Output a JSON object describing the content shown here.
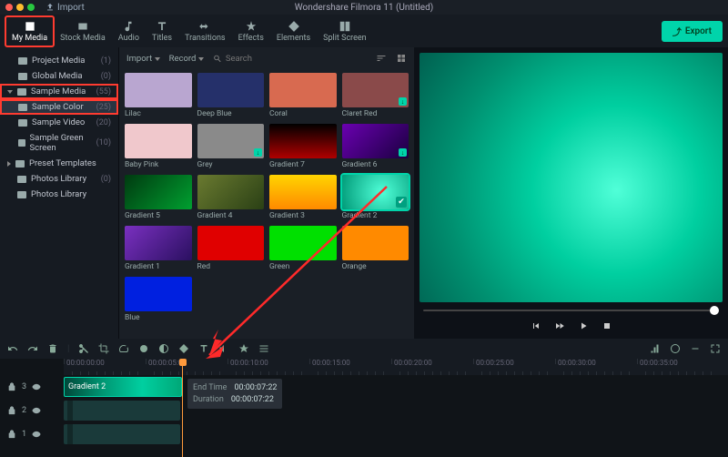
{
  "titlebar": {
    "title": "Wondershare Filmora 11 (Untitled)",
    "import_menu": "Import"
  },
  "tabs": [
    {
      "id": "my-media",
      "label": "My Media",
      "active": true,
      "highlight": true
    },
    {
      "id": "stock-media",
      "label": "Stock Media"
    },
    {
      "id": "audio",
      "label": "Audio"
    },
    {
      "id": "titles",
      "label": "Titles"
    },
    {
      "id": "transitions",
      "label": "Transitions"
    },
    {
      "id": "effects",
      "label": "Effects"
    },
    {
      "id": "elements",
      "label": "Elements"
    },
    {
      "id": "split-screen",
      "label": "Split Screen"
    }
  ],
  "export_label": "Export",
  "sidebar": [
    {
      "label": "Project Media",
      "count": "(1)",
      "indent": 1,
      "icon": "folder"
    },
    {
      "label": "Global Media",
      "count": "(0)",
      "indent": 1,
      "icon": "folder"
    },
    {
      "label": "Sample Media",
      "count": "(55)",
      "indent": 0,
      "chev": "down",
      "icon": "folder",
      "highlight": true
    },
    {
      "label": "Sample Color",
      "count": "(25)",
      "indent": 1,
      "icon": "folder",
      "sel": true,
      "highlight": true
    },
    {
      "label": "Sample Video",
      "count": "(20)",
      "indent": 1,
      "icon": "folder"
    },
    {
      "label": "Sample Green Screen",
      "count": "(10)",
      "indent": 1,
      "icon": "folder"
    },
    {
      "label": "Preset Templates",
      "count": "",
      "indent": 0,
      "chev": "right",
      "icon": "folder"
    },
    {
      "label": "Photos Library",
      "count": "(0)",
      "indent": 0,
      "icon": "folder"
    },
    {
      "label": "Photos Library",
      "count": "",
      "indent": 0,
      "icon": "photos"
    }
  ],
  "browser_bar": {
    "import": "Import",
    "record": "Record",
    "search_placeholder": "Search"
  },
  "colors": [
    {
      "label": "Lilac",
      "bg": "linear-gradient(#b9a6d0,#b9a6d0)"
    },
    {
      "label": "Deep Blue",
      "bg": "linear-gradient(#25306a,#25306a)"
    },
    {
      "label": "Coral",
      "bg": "linear-gradient(#d86a50,#d86a50)"
    },
    {
      "label": "Claret Red",
      "bg": "linear-gradient(#8a4a4a,#8a4a4a)",
      "dl": true
    },
    {
      "label": "Baby Pink",
      "bg": "linear-gradient(#f0c8cc,#f0c8cc)"
    },
    {
      "label": "Grey",
      "bg": "linear-gradient(#8a8a8a,#8a8a8a)",
      "dl": true
    },
    {
      "label": "Gradient 7",
      "bg": "linear-gradient(180deg,#000 0%,#b00000 100%)"
    },
    {
      "label": "Gradient 6",
      "bg": "linear-gradient(135deg,#6a00b0 0%,#1a0040 100%)",
      "dl": true
    },
    {
      "label": "Gradient 5",
      "bg": "linear-gradient(135deg,#003a10 0%,#00a030 100%)"
    },
    {
      "label": "Gradient 4",
      "bg": "linear-gradient(135deg,#6a7a30 0%,#2a4015 100%)"
    },
    {
      "label": "Gradient 3",
      "bg": "linear-gradient(180deg,#ffd400 0%,#ff8a00 100%)"
    },
    {
      "label": "Gradient 2",
      "bg": "radial-gradient(circle at 60% 50%,#50ffd8,#009a78)",
      "sel": true
    },
    {
      "label": "Gradient 1",
      "bg": "linear-gradient(135deg,#7a30c0 0%,#2a1060 100%)"
    },
    {
      "label": "Red",
      "bg": "linear-gradient(#e00000,#e00000)"
    },
    {
      "label": "Green",
      "bg": "linear-gradient(#00e000,#00e000)"
    },
    {
      "label": "Orange",
      "bg": "linear-gradient(#ff8a00,#ff8a00)"
    },
    {
      "label": "Blue",
      "bg": "linear-gradient(#0020e0,#0020e0)"
    }
  ],
  "ruler": [
    "00:00:00:00",
    "00:00:05:00",
    "00:00:10:00",
    "00:00:15:00",
    "00:00:20:00",
    "00:00:25:00",
    "00:00:30:00",
    "00:00:35:00"
  ],
  "clip": {
    "label": "Gradient 2"
  },
  "tooltip": {
    "end_label": "End Time",
    "end_val": "00:00:07:22",
    "dur_label": "Duration",
    "dur_val": "00:00:07:22"
  },
  "tracks": [
    {
      "head": "3"
    },
    {
      "head": "2"
    },
    {
      "head": "1"
    }
  ]
}
